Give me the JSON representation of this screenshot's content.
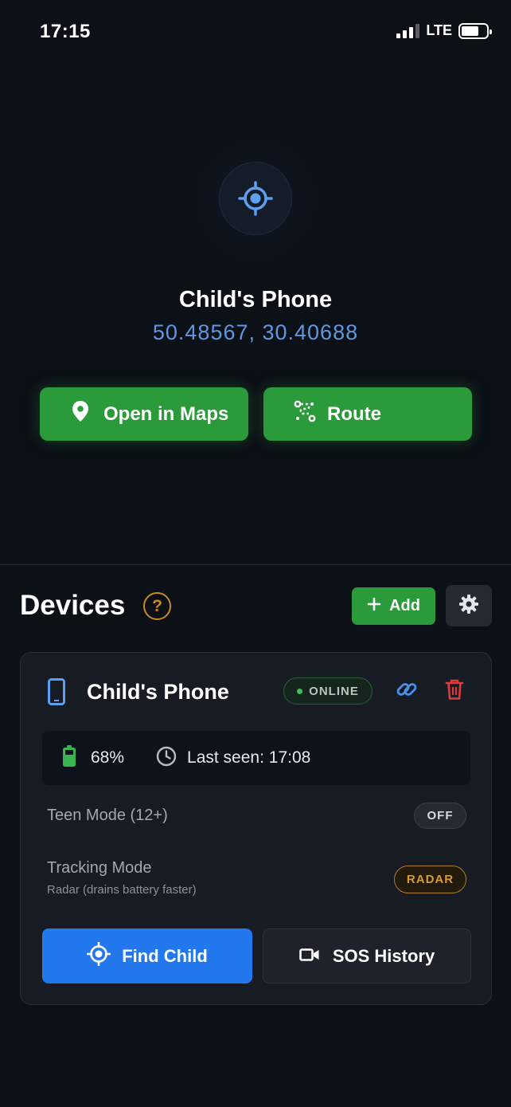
{
  "status_bar": {
    "time": "17:15",
    "network": "LTE",
    "icons": [
      "signal-icon",
      "battery-icon"
    ]
  },
  "hero": {
    "icon": "crosshair-icon",
    "device_name": "Child's Phone",
    "coordinates": "50.48567, 30.40688",
    "buttons": {
      "open_maps": "Open in Maps",
      "route": "Route"
    }
  },
  "devices": {
    "title": "Devices",
    "help": "?",
    "add_label": "Add",
    "device": {
      "name": "Child's Phone",
      "status": "ONLINE",
      "battery": "68%",
      "last_seen": "Last seen: 17:08",
      "teen_mode_label": "Teen Mode (12+)",
      "teen_mode_value": "OFF",
      "tracking_label": "Tracking Mode",
      "tracking_desc": "Radar (drains battery faster)",
      "tracking_value": "RADAR",
      "find_child": "Find Child",
      "sos_history": "SOS History"
    }
  },
  "colors": {
    "background": "#0c1017",
    "green": "#2a9a3a",
    "blue": "#2478ee",
    "coords_blue": "#5f97e3",
    "amber": "#d79c2c",
    "red": "#e03a3a"
  }
}
